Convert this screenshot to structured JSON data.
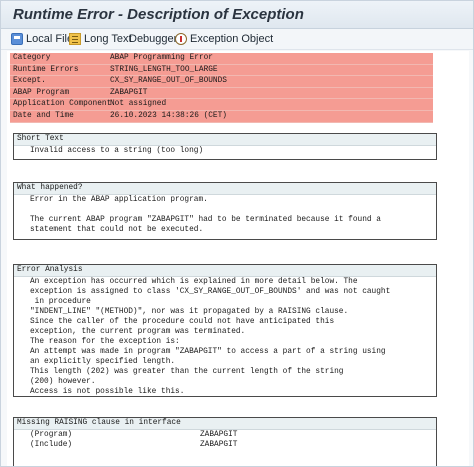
{
  "window": {
    "title": "Runtime Error - Description of Exception"
  },
  "toolbar": {
    "local_file": "Local File",
    "long_text": "Long Text",
    "debugger": "Debugger",
    "exception_object": "Exception Object"
  },
  "header": {
    "rows": [
      {
        "key": "Category",
        "value": "ABAP Programming Error"
      },
      {
        "key": "Runtime Errors",
        "value": "STRING_LENGTH_TOO_LARGE"
      },
      {
        "key": "Except.",
        "value": "CX_SY_RANGE_OUT_OF_BOUNDS"
      },
      {
        "key": "ABAP Program",
        "value": "ZABAPGIT"
      },
      {
        "key": "Application Component",
        "value": "Not assigned"
      },
      {
        "key": "Date and Time",
        "value": "26.10.2023 14:38:26 (CET)"
      }
    ]
  },
  "short_text": {
    "title": "Short Text",
    "line1": "Invalid access to a string (too long)"
  },
  "what_happened": {
    "title": "What happened?",
    "line1": "Error in the ABAP application program.",
    "line2": "",
    "line3": "The current ABAP program \"ZABAPGIT\" had to be terminated because it found a",
    "line4": "statement that could not be executed."
  },
  "error_analysis": {
    "title": "Error Analysis",
    "lines": [
      "An exception has occurred which is explained in more detail below. The",
      "exception is assigned to class 'CX_SY_RANGE_OUT_OF_BOUNDS' and was not caught",
      " in procedure",
      "\"INDENT_LINE\" \"(METHOD)\", nor was it propagated by a RAISING clause.",
      "Since the caller of the procedure could not have anticipated this",
      "exception, the current program was terminated.",
      "The reason for the exception is:",
      "An attempt was made in program \"ZABAPGIT\" to access a part of a string using",
      "an explicitly specified length.",
      "This length (202) was greater than the current length of the string",
      "(200) however.",
      "Access is not possible like this."
    ]
  },
  "missing_raising": {
    "title": "Missing RAISING clause in interface",
    "rows": [
      {
        "label": "(Program)",
        "value": "ZABAPGIT"
      },
      {
        "label": "(Include)",
        "value": "ZABAPGIT"
      }
    ]
  }
}
